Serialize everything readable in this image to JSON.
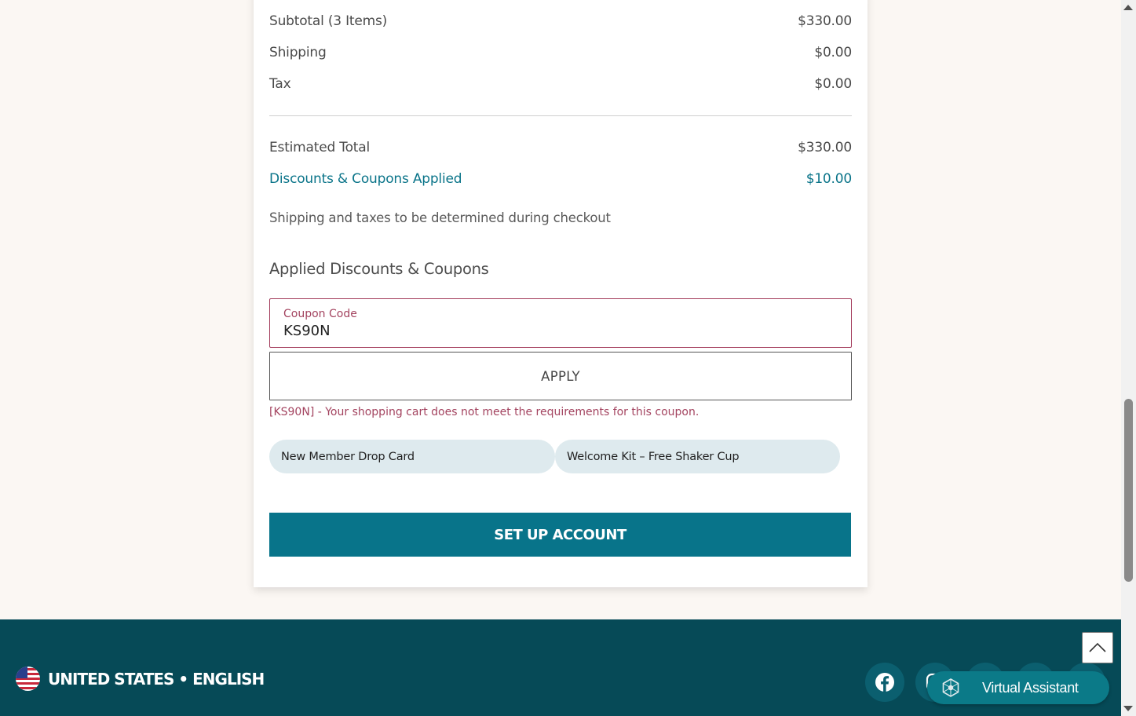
{
  "summary": {
    "subtotal_label": "Subtotal (3 Items)",
    "subtotal_value": "$330.00",
    "shipping_label": "Shipping",
    "shipping_value": "$0.00",
    "tax_label": "Tax",
    "tax_value": "$0.00",
    "estimated_total_label": "Estimated Total",
    "estimated_total_value": "$330.00",
    "discounts_label": "Discounts & Coupons Applied",
    "discounts_value": "$10.00",
    "note": "Shipping and taxes to be determined during checkout"
  },
  "coupons": {
    "section_title": "Applied Discounts & Coupons",
    "field_label": "Coupon Code",
    "field_value": "KS90N",
    "apply_label": "APPLY",
    "error_message": "[KS90N] - Your shopping cart does not meet the requirements for this coupon.",
    "applied": [
      "New Member Drop Card",
      "Welcome Kit – Free Shaker Cup"
    ]
  },
  "setup_button_label": "SET UP ACCOUNT",
  "footer": {
    "locale": "UNITED STATES • ENGLISH",
    "social_icons": [
      "facebook-icon"
    ]
  },
  "virtual_assistant_label": "Virtual Assistant",
  "colors": {
    "accent": "#08748a",
    "footer_bg": "#064a57",
    "error": "#a3435f",
    "chip_bg": "#deeaee"
  }
}
